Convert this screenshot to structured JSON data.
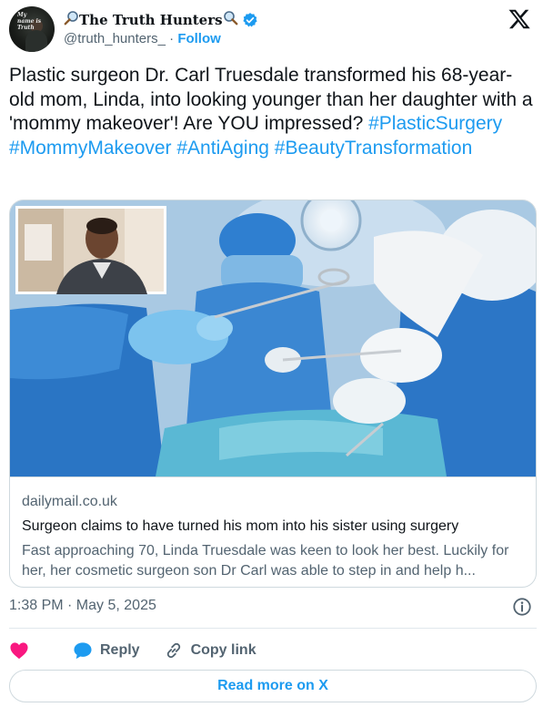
{
  "author": {
    "display_name": "The Truth Hunters",
    "name_prefix_icon": "magnifying-glass-icon",
    "name_suffix_icon": "magnifying-glass-icon",
    "handle": "@truth_hunters_",
    "separator": " · ",
    "follow_label": "Follow",
    "verified": true,
    "avatar_text": "My name is Truth"
  },
  "tweet": {
    "text": "Plastic surgeon Dr. Carl Truesdale transformed his 68-year-old mom, Linda, into looking younger than her daughter with a 'mommy makeover'!  Are YOU impressed?",
    "hashtags": "#PlasticSurgery #MommyMakeover #AntiAging #BeautyTransformation"
  },
  "card": {
    "domain": "dailymail.co.uk",
    "title": "Surgeon claims to have turned his mom into his sister using surgery",
    "description": "Fast approaching 70, Linda Truesdale was keen to look her best. Luckily for her, her cosmetic surgeon son Dr Carl was able to step in and help h..."
  },
  "timestamp": "1:38 PM · May 5, 2025",
  "actions": {
    "reply_label": "Reply",
    "copy_link_label": "Copy link"
  },
  "read_more_label": "Read more on X",
  "colors": {
    "accent": "#1d9bf0",
    "heart": "#f91880",
    "text": "#0f1419",
    "muted": "#536471",
    "border": "#cfd9de"
  }
}
